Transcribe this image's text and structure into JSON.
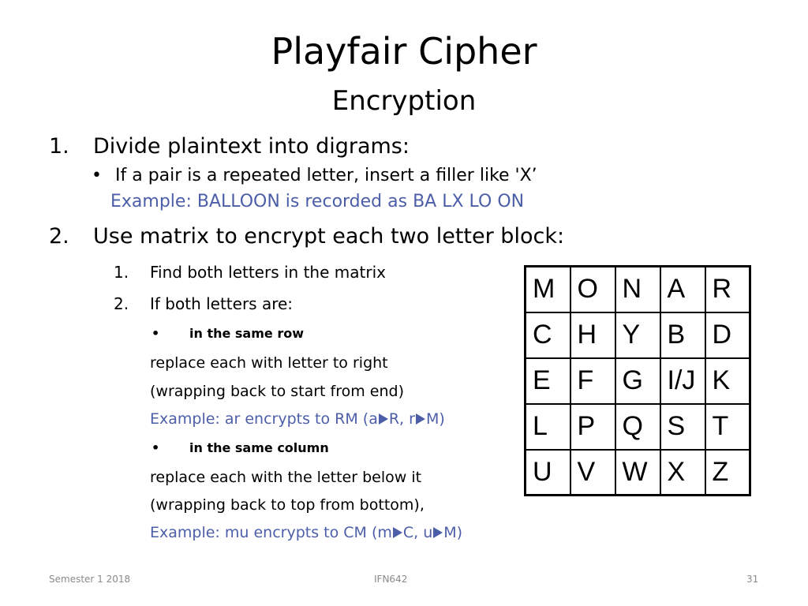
{
  "title": "Playfair Cipher",
  "subtitle": "Encryption",
  "step1": {
    "num": "1.",
    "text": "Divide plaintext into digrams:"
  },
  "step1_bullet": "If a pair is a repeated letter, insert a filler like 'X’",
  "step1_example": "Example:  BALLOON is recorded as BA LX LO ON",
  "step2": {
    "num": "2.",
    "text": "Use matrix to encrypt each two letter block:"
  },
  "sub1": {
    "num": "1.",
    "text": "Find both letters in the matrix"
  },
  "sub2": {
    "num": "2.",
    "text": "If both letters are:"
  },
  "row_case": {
    "heading": "in the same row",
    "line1": "replace each with letter to right",
    "line2": "(wrapping back to start from end)",
    "example_a": "Example: ar encrypts to RM (a",
    "example_b": "R, r",
    "example_c": "M)"
  },
  "col_case": {
    "heading": "in the same column",
    "line1": "replace each with the letter below it",
    "line2": "(wrapping back to top from bottom),",
    "example_a": "Example: mu encrypts to CM (m",
    "example_b": "C, u",
    "example_c": "M)"
  },
  "matrix": [
    [
      "M",
      "O",
      "N",
      "A",
      "R"
    ],
    [
      "C",
      "H",
      "Y",
      "B",
      "D"
    ],
    [
      "E",
      "F",
      "G",
      "I/J",
      "K"
    ],
    [
      "L",
      "P",
      "Q",
      "S",
      "T"
    ],
    [
      "U",
      "V",
      "W",
      "X",
      "Z"
    ]
  ],
  "footer": {
    "left": "Semester 1 2018",
    "center": "IFN642",
    "right": "31"
  },
  "colors": {
    "example_blue": "#4c5ea8",
    "footer_gray": "#8a8a8a"
  }
}
